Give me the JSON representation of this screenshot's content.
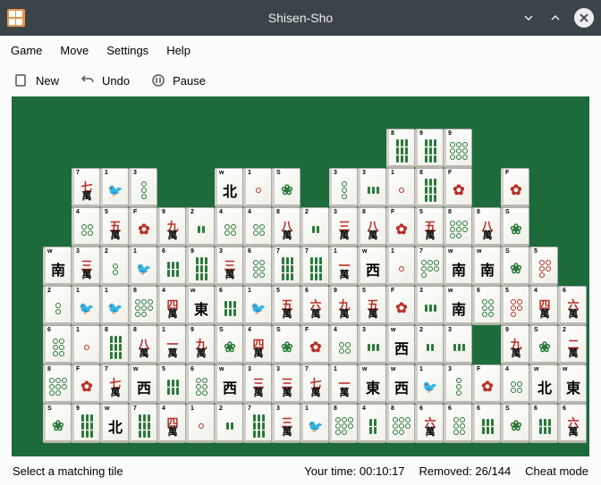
{
  "title": "Shisen-Sho",
  "menu": {
    "game": "Game",
    "move": "Move",
    "settings": "Settings",
    "help": "Help"
  },
  "toolbar": {
    "new": "New",
    "undo": "Undo",
    "pause": "Pause"
  },
  "status": {
    "hint": "Select a matching tile",
    "time_label": "Your time: ",
    "time": "00:10:17",
    "removed_label": "Removed: ",
    "removed": "26/144",
    "cheat": "Cheat mode"
  },
  "board": [
    [
      null,
      null,
      null,
      null,
      null,
      null,
      null,
      null,
      null,
      null,
      null,
      null,
      null,
      "b8",
      "b9",
      "d9",
      null,
      null,
      null,
      null
    ],
    [
      null,
      null,
      "w7",
      "b1",
      "d3",
      null,
      null,
      "wN",
      "d1",
      "S",
      null,
      "d3",
      "b3",
      "d1",
      "b8",
      "F",
      null,
      "F",
      null,
      null
    ],
    [
      null,
      null,
      "d4",
      "w5",
      "F",
      "w9",
      "b2",
      "d4",
      "d4",
      "w8",
      "b2",
      "w3",
      "w8",
      "F",
      "w5",
      "d8",
      "w8",
      "S",
      null,
      null
    ],
    [
      null,
      "wS",
      "w3",
      "d2",
      "b1",
      "b6",
      "b9",
      "w3",
      "d6",
      "b7",
      "b7",
      "w1",
      "wW",
      "d1",
      "d7",
      "wS",
      "wS",
      "S",
      "d5",
      null
    ],
    [
      null,
      "d2",
      "b1",
      "b1",
      "d8",
      "w4",
      "wE",
      "b6",
      "b1",
      "w5",
      "w6",
      "w9",
      "w5",
      "F",
      "b3",
      "wS",
      "d6",
      "d5",
      "w4",
      "w6"
    ],
    [
      null,
      "d6",
      "d1",
      "b8",
      "w8",
      "w1",
      "w9",
      "S",
      "w4",
      "S",
      "F",
      "d4",
      "b3",
      "wW",
      "b2",
      "b3",
      null,
      "w9",
      "S",
      "w2"
    ],
    [
      null,
      "d8",
      "F",
      "w7",
      "wW",
      "b5",
      "d6",
      "wW",
      "w3",
      "w3",
      "w7",
      "w1",
      "wE",
      "wW",
      "b1",
      "d3",
      "F",
      "d4",
      "wN",
      "wE"
    ],
    [
      null,
      "S",
      "b9",
      "wN",
      "b7",
      "w4",
      "d1",
      "b2",
      "b7",
      "w3",
      "b1",
      "d8",
      "b4",
      "d8",
      "w6",
      "d6",
      "b6",
      "S",
      "b6",
      "w6"
    ]
  ],
  "wan_chars": {
    "1": "一",
    "2": "二",
    "3": "三",
    "4": "四",
    "5": "五",
    "6": "六",
    "7": "七",
    "8": "八",
    "9": "九"
  },
  "winds": {
    "N": "北",
    "S": "南",
    "E": "東",
    "W": "西"
  },
  "flower": "✿",
  "season": "❀",
  "bird": "🐦"
}
